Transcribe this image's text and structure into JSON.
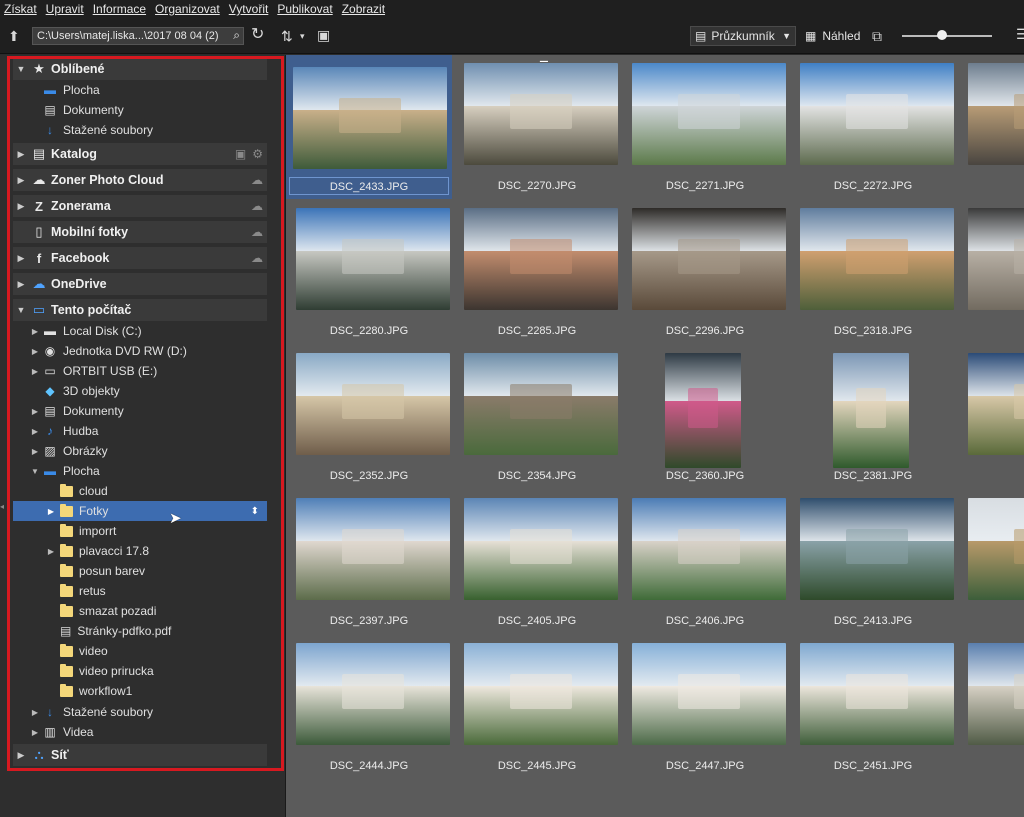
{
  "menu": [
    "Získat",
    "Upravit",
    "Informace",
    "Organizovat",
    "Vytvořit",
    "Publikovat",
    "Zobrazit"
  ],
  "toolbar": {
    "path": "C:\\Users\\matej.liska...\\2017 08 04 (2)",
    "view_mode": "Průzkumník",
    "preview_label": "Náhled"
  },
  "sidebar": {
    "favorites": {
      "label": "Oblíbené",
      "items": [
        "Plocha",
        "Dokumenty",
        "Stažené soubory"
      ]
    },
    "sections": [
      "Katalog",
      "Zoner Photo Cloud",
      "Zonerama",
      "Mobilní fotky",
      "Facebook",
      "OneDrive"
    ],
    "computer": {
      "label": "Tento počítač",
      "items": [
        "Local Disk (C:)",
        "Jednotka DVD RW (D:)",
        "ORTBIT USB (E:)",
        "3D objekty",
        "Dokumenty",
        "Hudba",
        "Obrázky",
        "Plocha"
      ],
      "plocha_children": [
        "cloud",
        "Fotky",
        "imporrt",
        "plavacci 17.8",
        "posun barev",
        "retus",
        "smazat pozadi",
        "Stránky-pdfko.pdf",
        "video",
        "video prirucka",
        "workflow1"
      ],
      "after": [
        "Stažené soubory",
        "Videa"
      ]
    },
    "network": "Síť"
  },
  "photos": [
    [
      "DSC_2433.JPG",
      "DSC_2270.JPG",
      "DSC_2271.JPG",
      "DSC_2272.JPG",
      "DSC"
    ],
    [
      "DSC_2280.JPG",
      "DSC_2285.JPG",
      "DSC_2296.JPG",
      "DSC_2318.JPG",
      "DSC"
    ],
    [
      "DSC_2352.JPG",
      "DSC_2354.JPG",
      "DSC_2360.JPG",
      "DSC_2381.JPG",
      "DSC"
    ],
    [
      "DSC_2397.JPG",
      "DSC_2405.JPG",
      "DSC_2406.JPG",
      "DSC_2413.JPG",
      "DSC"
    ],
    [
      "DSC_2444.JPG",
      "DSC_2445.JPG",
      "DSC_2447.JPG",
      "DSC_2451.JPG",
      "DSC"
    ]
  ],
  "colors": {
    "selection": "#3d6cb0",
    "highlight_border": "#d71920",
    "folder": "#f4d77a"
  }
}
